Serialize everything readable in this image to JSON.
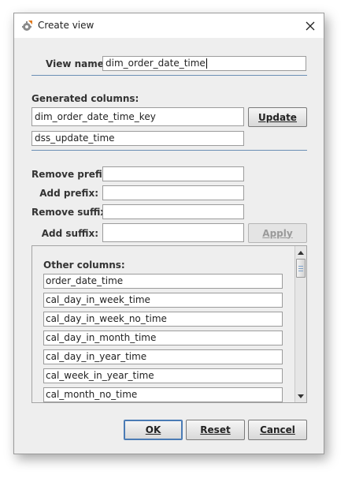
{
  "window": {
    "title": "Create view",
    "icon": "app-gear-icon",
    "close_icon": "close-icon"
  },
  "view_name": {
    "label": "View name:",
    "value": "dim_order_date_time"
  },
  "generated_columns": {
    "label": "Generated columns:",
    "items": [
      "dim_order_date_time_key",
      "dss_update_time"
    ],
    "update_button_label": "Update"
  },
  "affixes": {
    "remove_prefix_label": "Remove prefix:",
    "remove_prefix_value": "",
    "add_prefix_label": "Add prefix:",
    "add_prefix_value": "",
    "remove_suffix_label": "Remove suffix:",
    "remove_suffix_value": "",
    "add_suffix_label": "Add suffix:",
    "add_suffix_value": "",
    "apply_button_label": "Apply"
  },
  "other_columns": {
    "label": "Other columns:",
    "items": [
      "order_date_time",
      "cal_day_in_week_time",
      "cal_day_in_week_no_time",
      "cal_day_in_month_time",
      "cal_day_in_year_time",
      "cal_week_in_year_time",
      "cal_month_no_time"
    ]
  },
  "buttons": {
    "ok_label": "OK",
    "reset_label": "Reset",
    "cancel_label": "Cancel"
  },
  "colors": {
    "separator": "#6b8fb5",
    "dialog_bg": "#eeeeee",
    "focus_border": "#4a7bb5"
  }
}
